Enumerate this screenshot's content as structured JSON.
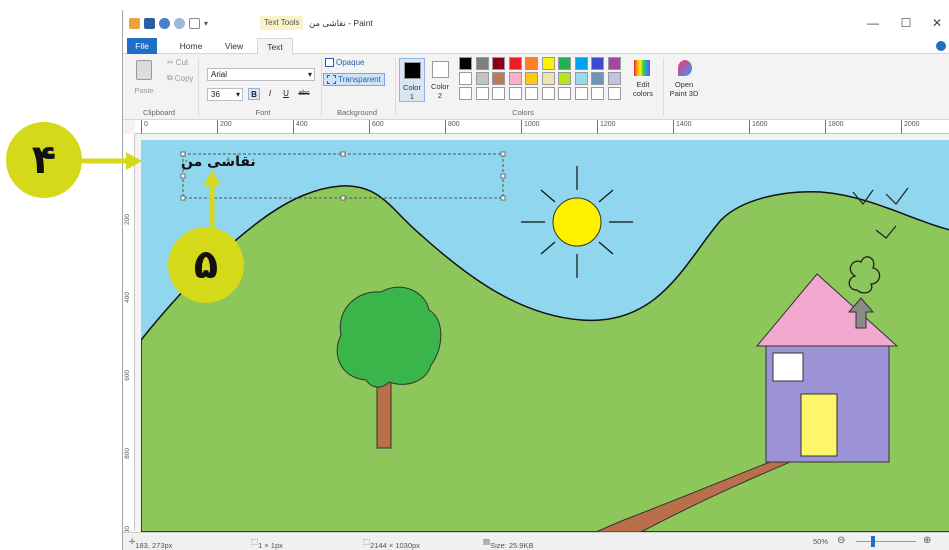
{
  "titlebar": {
    "context_tab": "Text Tools",
    "title": "نقاشی من - Paint",
    "minimize": "—",
    "maximize": "☐",
    "close": "✕"
  },
  "tabs": [
    {
      "label": "File"
    },
    {
      "label": "Home"
    },
    {
      "label": "View"
    },
    {
      "label": "Text"
    }
  ],
  "ribbon": {
    "clipboard": {
      "paste": "Paste",
      "cut": "Cut",
      "copy": "Copy",
      "group": "Clipboard"
    },
    "font": {
      "family": "Arial",
      "size": "36",
      "bold": "B",
      "italic": "I",
      "underline": "U",
      "strike": "abc",
      "group": "Font"
    },
    "background": {
      "opaque": "Opaque",
      "transparent": "Transparent",
      "group": "Background"
    },
    "colors": {
      "color1": "Color 1",
      "color2": "Color 2",
      "edit": "Edit colors",
      "group": "Colors",
      "color1_value": "#000000",
      "color2_value": "#ffffff",
      "palette_row1": [
        "#000000",
        "#7f7f7f",
        "#880015",
        "#ed1c24",
        "#ff7f27",
        "#fff200",
        "#22b14c",
        "#00a2e8",
        "#3f48cc",
        "#a349a4"
      ],
      "palette_row2": [
        "#ffffff",
        "#c3c3c3",
        "#b97a57",
        "#ffaec9",
        "#ffc90e",
        "#efe4b0",
        "#b5e61d",
        "#99d9ea",
        "#7092be",
        "#c8bfe7"
      ],
      "palette_row3": [
        "#ffffff",
        "#ffffff",
        "#ffffff",
        "#ffffff",
        "#ffffff",
        "#ffffff",
        "#ffffff",
        "#ffffff",
        "#ffffff",
        "#ffffff"
      ]
    },
    "paint3d": "Open Paint 3D"
  },
  "ruler": {
    "marks": [
      "0",
      "200",
      "400",
      "600",
      "800",
      "1000",
      "1200",
      "1400",
      "1600",
      "1800",
      "2000"
    ],
    "vmarks": [
      "200",
      "400",
      "600",
      "800",
      "1000"
    ]
  },
  "canvas": {
    "text_box_content": "نقاشی من",
    "sky_color": "#8fd6ee",
    "grass_color": "#8dc65a"
  },
  "status": {
    "cursor": "183, 273px",
    "selection": "1 × 1px",
    "image_size": "2144 × 1030px",
    "file_size": "Size: 25.9KB",
    "zoom": "50%"
  },
  "callouts": {
    "four": "۴",
    "five": "۵",
    "color": "#d4da1a"
  }
}
